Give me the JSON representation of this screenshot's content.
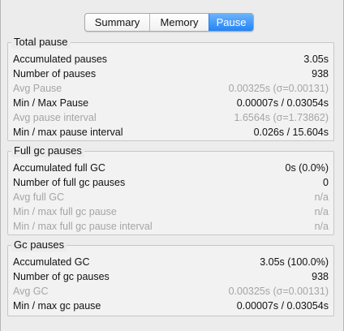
{
  "tabs": [
    {
      "label": "Summary",
      "selected": false
    },
    {
      "label": "Memory",
      "selected": false
    },
    {
      "label": "Pause",
      "selected": true
    }
  ],
  "colors": {
    "accent": "#2f8cf8",
    "dim_text": "#a5a5a5"
  },
  "total_pause": {
    "title": "Total pause",
    "rows": [
      {
        "label": "Accumulated pauses",
        "value": "3.05s",
        "dim": false
      },
      {
        "label": "Number of pauses",
        "value": "938",
        "dim": false
      },
      {
        "label": "Avg Pause",
        "value": "0.00325s (σ=0.00131)",
        "dim": true
      },
      {
        "label": "Min / Max Pause",
        "value": "0.00007s / 0.03054s",
        "dim": false
      },
      {
        "label": "Avg pause interval",
        "value": "1.6564s (σ=1.73862)",
        "dim": true
      },
      {
        "label": "Min / max pause interval",
        "value": "0.026s / 15.604s",
        "dim": false
      }
    ]
  },
  "full_gc_pauses": {
    "title": "Full gc pauses",
    "rows": [
      {
        "label": "Accumulated full GC",
        "value": "0s (0.0%)",
        "dim": false
      },
      {
        "label": "Number of full gc pauses",
        "value": "0",
        "dim": false
      },
      {
        "label": "Avg full GC",
        "value": "n/a",
        "dim": true
      },
      {
        "label": "Min / max full gc pause",
        "value": "n/a",
        "dim": true
      },
      {
        "label": "Min / max full gc pause interval",
        "value": "n/a",
        "dim": true
      }
    ]
  },
  "gc_pauses": {
    "title": "Gc pauses",
    "rows": [
      {
        "label": "Accumulated GC",
        "value": "3.05s (100.0%)",
        "dim": false
      },
      {
        "label": "Number of gc pauses",
        "value": "938",
        "dim": false
      },
      {
        "label": "Avg GC",
        "value": "0.00325s (σ=0.00131)",
        "dim": true
      },
      {
        "label": "Min / max gc pause",
        "value": "0.00007s / 0.03054s",
        "dim": false
      }
    ]
  }
}
